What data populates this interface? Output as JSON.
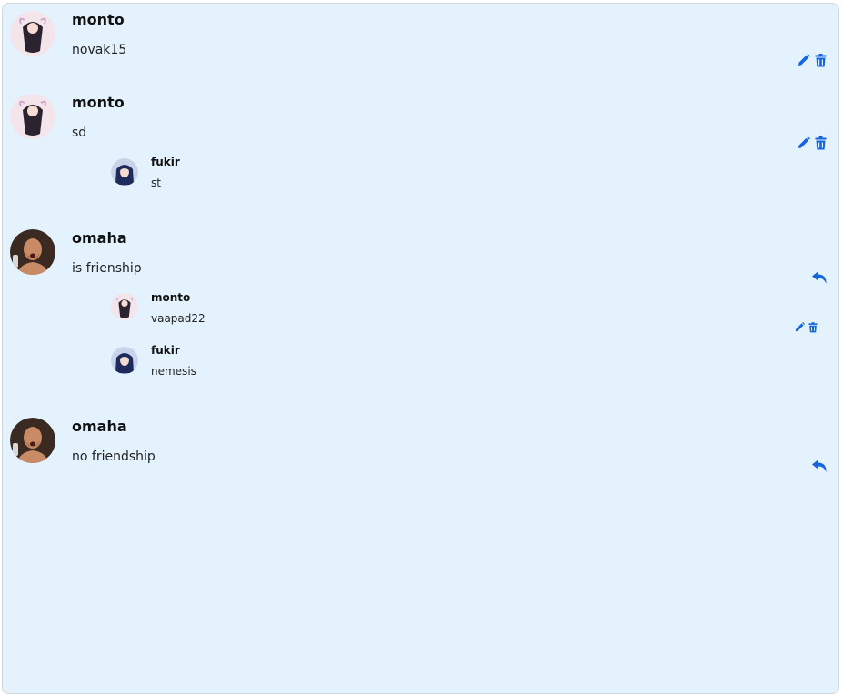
{
  "colors": {
    "panel_background": "#e3f2fd",
    "icon_accent": "#1565e0"
  },
  "comments": [
    {
      "author": "monto",
      "text": "novak15",
      "avatar": "anime-girl-avatar",
      "actions": [
        "edit-icon",
        "delete-icon"
      ],
      "replies": []
    },
    {
      "author": "monto",
      "text": "sd",
      "avatar": "anime-girl-avatar",
      "actions": [
        "edit-icon",
        "delete-icon"
      ],
      "replies": [
        {
          "author": "fukir",
          "text": "st",
          "avatar": "blue-hair-avatar",
          "actions": []
        }
      ]
    },
    {
      "author": "omaha",
      "text": "is frienship",
      "avatar": "fighter-photo-avatar",
      "actions": [
        "reply-icon"
      ],
      "replies": [
        {
          "author": "monto",
          "text": "vaapad22",
          "avatar": "anime-girl-avatar",
          "actions": [
            "edit-icon",
            "delete-icon"
          ]
        },
        {
          "author": "fukir",
          "text": "nemesis",
          "avatar": "blue-hair-avatar",
          "actions": []
        }
      ]
    },
    {
      "author": "omaha",
      "text": "no friendship",
      "avatar": "fighter-photo-avatar",
      "actions": [
        "reply-icon"
      ],
      "replies": []
    }
  ]
}
